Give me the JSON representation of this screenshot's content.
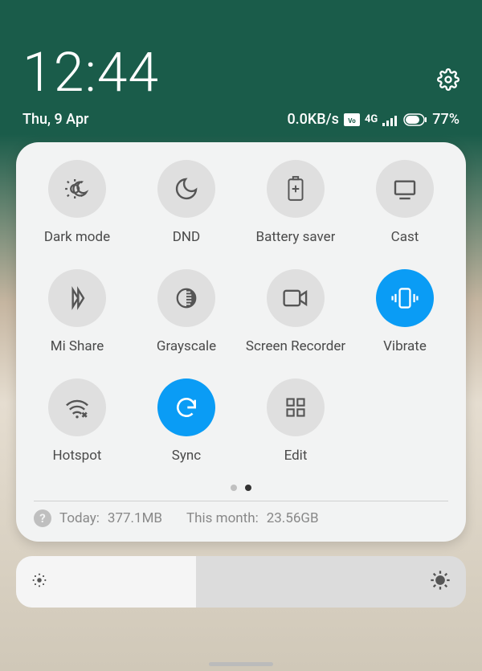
{
  "header": {
    "time": "12:44",
    "date": "Thu, 9 Apr"
  },
  "status": {
    "speed": "0.0KB/s",
    "volte": "VoLTE",
    "network": "4G",
    "battery_pct": "77%"
  },
  "tiles": [
    {
      "id": "dark-mode",
      "label": "Dark mode",
      "active": false
    },
    {
      "id": "dnd",
      "label": "DND",
      "active": false
    },
    {
      "id": "battery-saver",
      "label": "Battery saver",
      "active": false
    },
    {
      "id": "cast",
      "label": "Cast",
      "active": false
    },
    {
      "id": "mi-share",
      "label": "Mi Share",
      "active": false
    },
    {
      "id": "grayscale",
      "label": "Grayscale",
      "active": false
    },
    {
      "id": "screen-recorder",
      "label": "Screen Recorder",
      "active": false
    },
    {
      "id": "vibrate",
      "label": "Vibrate",
      "active": true
    },
    {
      "id": "hotspot",
      "label": "Hotspot",
      "active": false
    },
    {
      "id": "sync",
      "label": "Sync",
      "active": true
    },
    {
      "id": "edit",
      "label": "Edit",
      "active": false
    }
  ],
  "pager": {
    "index": 1,
    "count": 2
  },
  "usage": {
    "today_label": "Today:",
    "today_value": "377.1MB",
    "month_label": "This month:",
    "month_value": "23.56GB"
  },
  "brightness": {
    "level_pct": 40
  },
  "colors": {
    "accent": "#0a9cf5"
  }
}
